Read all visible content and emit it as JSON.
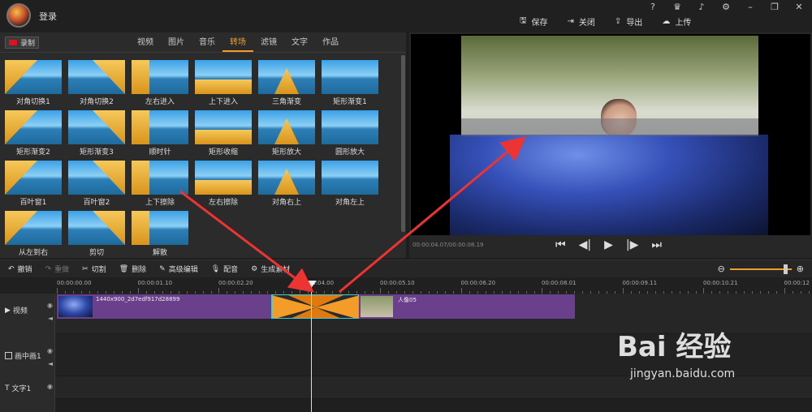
{
  "header": {
    "login_label": "登录",
    "window_buttons": [
      "?",
      "VIP",
      "bell",
      "gear",
      "minimize",
      "restore",
      "close"
    ],
    "actions": [
      {
        "label": "保存",
        "icon": "save-icon"
      },
      {
        "label": "关闭",
        "icon": "close-project-icon"
      },
      {
        "label": "导出",
        "icon": "export-icon"
      },
      {
        "label": "上传",
        "icon": "upload-icon"
      }
    ]
  },
  "media_panel": {
    "record_label": "录制",
    "tabs": [
      "视频",
      "图片",
      "音乐",
      "转场",
      "滤镜",
      "文字",
      "作品"
    ],
    "active_tab": "转场",
    "transitions": [
      "对角切换1",
      "对角切换2",
      "左右进入",
      "上下进入",
      "三角渐变",
      "矩形渐变1",
      "矩形渐变2",
      "矩形渐变3",
      "顺时针",
      "矩形收缩",
      "矩形放大",
      "圆形放大",
      "百叶窗1",
      "百叶窗2",
      "上下擦除",
      "左右擦除",
      "对角右上",
      "对角左上",
      "从左到右",
      "剪切",
      "解散"
    ]
  },
  "preview": {
    "timecode": "00:00:04.07/00:00:08.19",
    "controls": [
      "skip-start",
      "prev-frame",
      "play",
      "next-frame",
      "skip-end"
    ]
  },
  "toolbar": {
    "undo": "撤销",
    "redo": "重做",
    "cut": "切割",
    "delete": "删除",
    "advanced_edit": "高级编辑",
    "dub": "配音",
    "generate": "生成素材",
    "zoom_level": 0.85
  },
  "timeline": {
    "ruler": [
      "00:00:00.00",
      "00:00:01.10",
      "00:00:02.20",
      "00:00:04.00",
      "00:00:05.10",
      "00:00:06.20",
      "00:00:08.01",
      "00:00:09.11",
      "00:00:10.21",
      "00:00:12"
    ],
    "tracks": [
      "视频",
      "画中画1",
      "文字1"
    ],
    "clips": [
      {
        "label": "1440x900_2d7edf917d28899"
      },
      {
        "label": "人像05"
      }
    ],
    "transition_color": "#f39c2a"
  },
  "watermark": {
    "logo": "Bai 经验",
    "url": "jingyan.baidu.com"
  }
}
